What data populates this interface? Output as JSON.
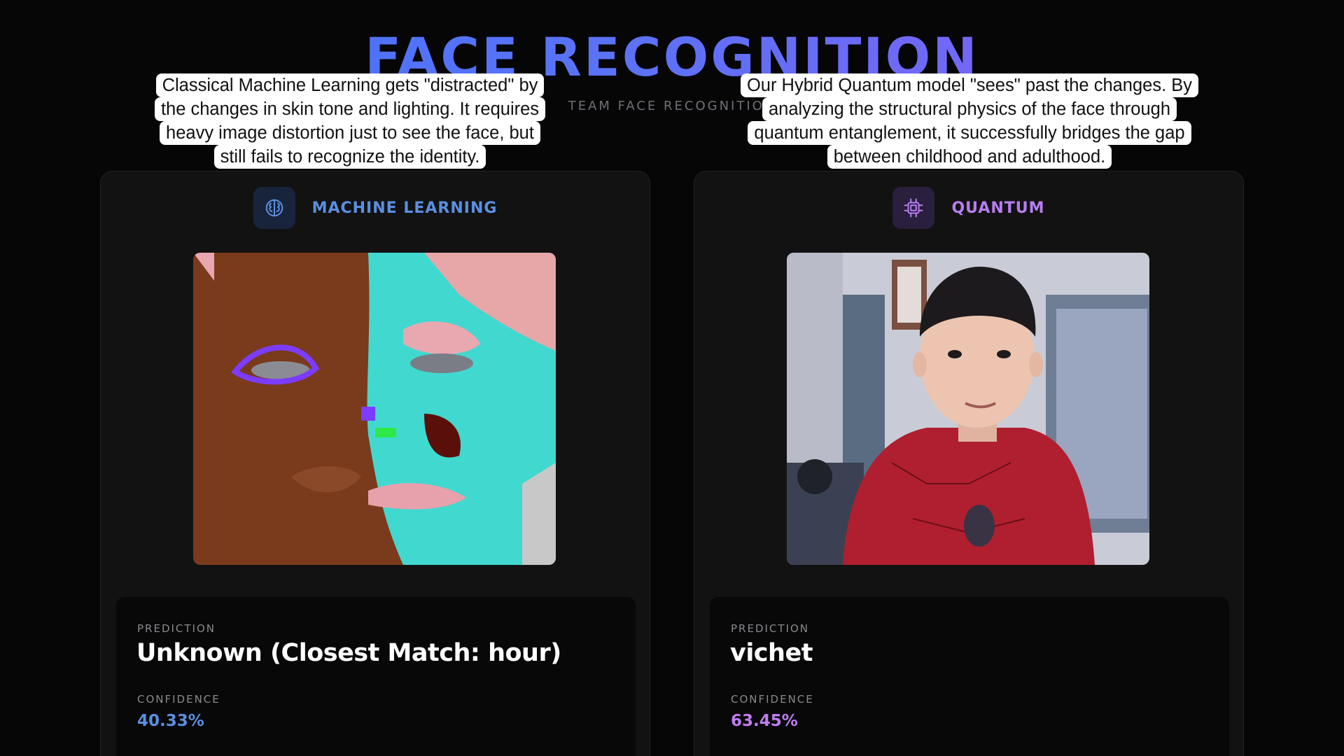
{
  "header": {
    "title": "FACE RECOGNITION",
    "subtitle": "TEAM FACE RECOGNITION"
  },
  "captions": {
    "left": [
      "Classical Machine Learning gets \"distracted\" by",
      "the changes in skin tone and lighting. It requires",
      "heavy image distortion just to see the face, but",
      "still fails to recognize the identity."
    ],
    "right": [
      "Our Hybrid Quantum model \"sees\" past the changes. By",
      "analyzing the structural physics of the face through",
      "quantum entanglement, it successfully bridges the gap",
      "between childhood and adulthood."
    ]
  },
  "panels": {
    "ml": {
      "title": "MACHINE LEARNING",
      "icon": "brain-icon",
      "accent": "#5b8fe0",
      "prediction_label": "PREDICTION",
      "prediction": "Unknown (Closest Match: hour)",
      "confidence_label": "CONFIDENCE",
      "confidence": "40.33%"
    },
    "quantum": {
      "title": "QUANTUM",
      "icon": "cpu-chip-icon",
      "accent": "#b77ef0",
      "prediction_label": "PREDICTION",
      "prediction": "vichet",
      "confidence_label": "CONFIDENCE",
      "confidence": "63.45%"
    }
  }
}
